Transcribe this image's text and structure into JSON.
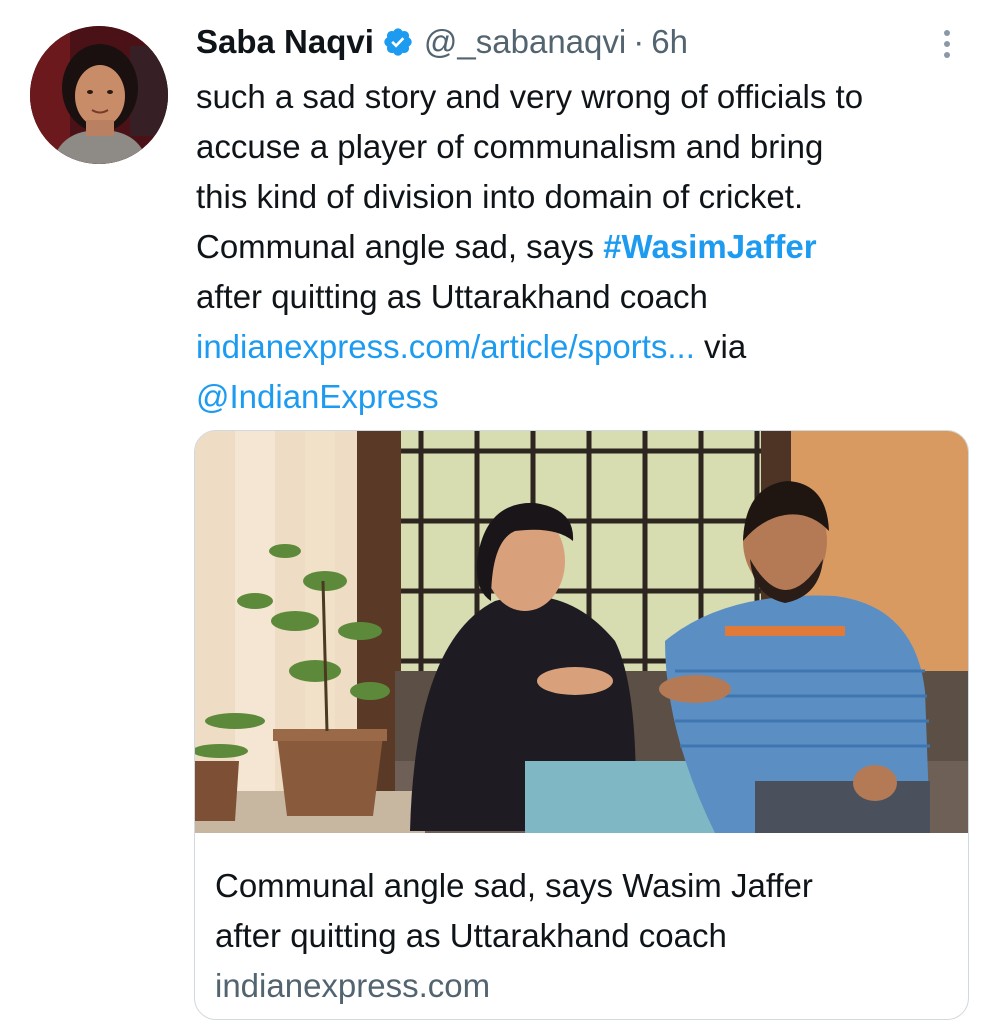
{
  "tweet": {
    "author": {
      "name": "Saba Naqvi",
      "handle": "@_sabanaqvi",
      "separator": "·",
      "time": "6h"
    },
    "text_lines": [
      "such a sad story and very wrong of officials to",
      "accuse a player of communalism and bring",
      "this kind of division into domain of cricket.",
      "Communal angle sad, says ",
      "#WasimJaffer",
      "after quitting as Uttarakhand coach",
      "indianexpress.com/article/sports...",
      " via",
      "@IndianExpress"
    ],
    "card": {
      "title_lines": [
        "Communal angle sad, says Wasim Jaffer",
        "after quitting as Uttarakhand coach"
      ],
      "domain": "indianexpress.com"
    },
    "icons": {
      "verified": "verified-badge-icon",
      "more": "more-options-icon"
    }
  },
  "colors": {
    "text": "#0f1419",
    "secondary": "#536471",
    "link": "#1d9bf0",
    "border": "#cfd9de"
  }
}
